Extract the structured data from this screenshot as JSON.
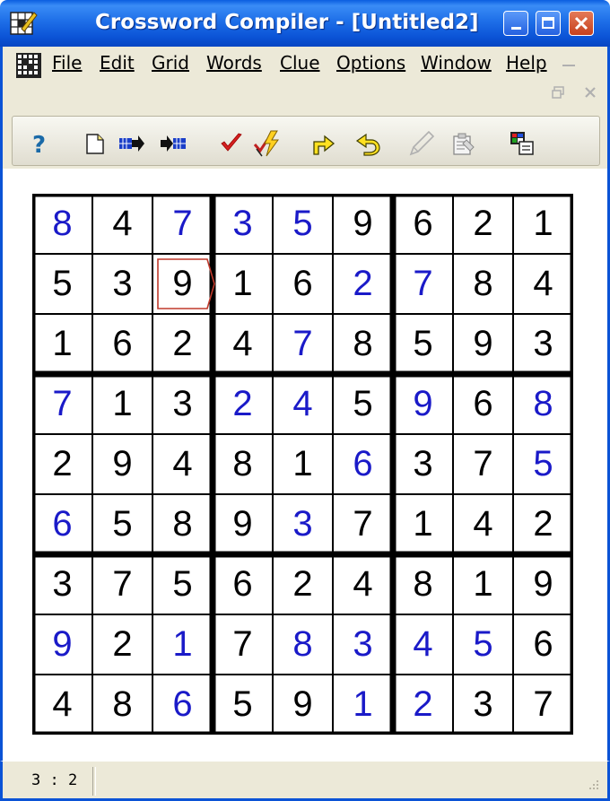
{
  "window": {
    "title": "Crossword Compiler - [Untitled2]"
  },
  "menu": [
    {
      "label": "File",
      "id": "file"
    },
    {
      "label": "Edit",
      "id": "edit"
    },
    {
      "label": "Grid",
      "id": "grid"
    },
    {
      "label": "Words",
      "id": "words"
    },
    {
      "label": "Clue",
      "id": "clue"
    },
    {
      "label": "Options",
      "id": "options"
    },
    {
      "label": "Window",
      "id": "window"
    },
    {
      "label": "Help",
      "id": "help"
    }
  ],
  "toolbar": [
    {
      "name": "help-icon"
    },
    {
      "name": "new-document-icon"
    },
    {
      "name": "export-arrow-icon"
    },
    {
      "name": "import-arrow-icon"
    },
    {
      "name": "checkmark-icon"
    },
    {
      "name": "auto-fill-lightning-icon"
    },
    {
      "name": "redo-arrow-icon"
    },
    {
      "name": "undo-arrow-icon"
    },
    {
      "name": "pencil-icon"
    },
    {
      "name": "clipboard-icon"
    },
    {
      "name": "properties-icon"
    }
  ],
  "sudoku": {
    "rows": [
      [
        "8",
        "4",
        "7",
        "3",
        "5",
        "9",
        "6",
        "2",
        "1"
      ],
      [
        "5",
        "3",
        "9",
        "1",
        "6",
        "2",
        "7",
        "8",
        "4"
      ],
      [
        "1",
        "6",
        "2",
        "4",
        "7",
        "8",
        "5",
        "9",
        "3"
      ],
      [
        "7",
        "1",
        "3",
        "2",
        "4",
        "5",
        "9",
        "6",
        "8"
      ],
      [
        "2",
        "9",
        "4",
        "8",
        "1",
        "6",
        "3",
        "7",
        "5"
      ],
      [
        "6",
        "5",
        "8",
        "9",
        "3",
        "7",
        "1",
        "4",
        "2"
      ],
      [
        "3",
        "7",
        "5",
        "6",
        "2",
        "4",
        "8",
        "1",
        "9"
      ],
      [
        "9",
        "2",
        "1",
        "7",
        "8",
        "3",
        "4",
        "5",
        "6"
      ],
      [
        "4",
        "8",
        "6",
        "5",
        "9",
        "1",
        "2",
        "3",
        "7"
      ]
    ],
    "entered": [
      [
        1,
        0,
        1,
        1,
        1,
        0,
        0,
        0,
        0
      ],
      [
        0,
        0,
        0,
        0,
        0,
        1,
        1,
        0,
        0
      ],
      [
        0,
        0,
        0,
        0,
        1,
        0,
        0,
        0,
        0
      ],
      [
        1,
        0,
        0,
        1,
        1,
        0,
        1,
        0,
        1
      ],
      [
        0,
        0,
        0,
        0,
        0,
        1,
        0,
        0,
        1
      ],
      [
        1,
        0,
        0,
        0,
        1,
        0,
        0,
        0,
        0
      ],
      [
        0,
        0,
        0,
        0,
        0,
        0,
        0,
        0,
        0
      ],
      [
        1,
        0,
        1,
        0,
        1,
        1,
        1,
        1,
        0
      ],
      [
        0,
        0,
        1,
        0,
        0,
        1,
        1,
        0,
        0
      ]
    ],
    "selected": {
      "row": 2,
      "col": 3
    },
    "colors": {
      "given": "#000000",
      "entered": "#1a1ac8",
      "cursor": "#c0392b"
    }
  },
  "status": {
    "position": "3 : 2"
  }
}
